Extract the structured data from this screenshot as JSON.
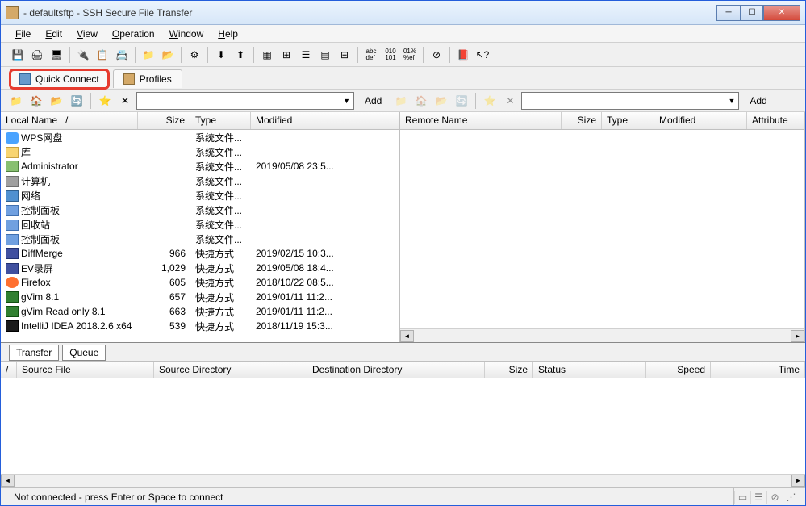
{
  "window": {
    "title": " - defaultsftp - SSH Secure File Transfer"
  },
  "menu": {
    "file": "File",
    "edit": "Edit",
    "view": "View",
    "operation": "Operation",
    "window": "Window",
    "help": "Help"
  },
  "tabs": {
    "quick_connect": "Quick Connect",
    "profiles": "Profiles"
  },
  "nav": {
    "add": "Add"
  },
  "local": {
    "headers": {
      "name": "Local Name",
      "size": "Size",
      "type": "Type",
      "modified": "Modified"
    },
    "files": [
      {
        "name": "WPS网盘",
        "size": "",
        "type": "系统文件...",
        "modified": "",
        "icon": "cloud"
      },
      {
        "name": "库",
        "size": "",
        "type": "系统文件...",
        "modified": "",
        "icon": "folder"
      },
      {
        "name": "Administrator",
        "size": "",
        "type": "系统文件...",
        "modified": "2019/05/08 23:5...",
        "icon": "user"
      },
      {
        "name": "计算机",
        "size": "",
        "type": "系统文件...",
        "modified": "",
        "icon": "computer"
      },
      {
        "name": "网络",
        "size": "",
        "type": "系统文件...",
        "modified": "",
        "icon": "network"
      },
      {
        "name": "控制面板",
        "size": "",
        "type": "系统文件...",
        "modified": "",
        "icon": "panel"
      },
      {
        "name": "回收站",
        "size": "",
        "type": "系统文件...",
        "modified": "",
        "icon": "panel"
      },
      {
        "name": "控制面板",
        "size": "",
        "type": "系统文件...",
        "modified": "",
        "icon": "panel"
      },
      {
        "name": "DiffMerge",
        "size": "966",
        "type": "快捷方式",
        "modified": "2019/02/15 10:3...",
        "icon": "app"
      },
      {
        "name": "EV录屏",
        "size": "1,029",
        "type": "快捷方式",
        "modified": "2019/05/08 18:4...",
        "icon": "app"
      },
      {
        "name": "Firefox",
        "size": "605",
        "type": "快捷方式",
        "modified": "2018/10/22 08:5...",
        "icon": "firefox"
      },
      {
        "name": "gVim 8.1",
        "size": "657",
        "type": "快捷方式",
        "modified": "2019/01/11 11:2...",
        "icon": "vim"
      },
      {
        "name": "gVim Read only 8.1",
        "size": "663",
        "type": "快捷方式",
        "modified": "2019/01/11 11:2...",
        "icon": "vim"
      },
      {
        "name": "IntelliJ IDEA 2018.2.6 x64",
        "size": "539",
        "type": "快捷方式",
        "modified": "2018/11/19 15:3...",
        "icon": "idea"
      }
    ]
  },
  "remote": {
    "headers": {
      "name": "Remote Name",
      "size": "Size",
      "type": "Type",
      "modified": "Modified",
      "attributes": "Attribute"
    }
  },
  "bottom": {
    "tabs": {
      "transfer": "Transfer",
      "queue": "Queue"
    },
    "headers": {
      "dir_arrow": "/",
      "source_file": "Source File",
      "source_dir": "Source Directory",
      "dest_dir": "Destination Directory",
      "size": "Size",
      "status": "Status",
      "speed": "Speed",
      "time": "Time"
    }
  },
  "status": {
    "text": "Not connected - press Enter or Space to connect"
  }
}
